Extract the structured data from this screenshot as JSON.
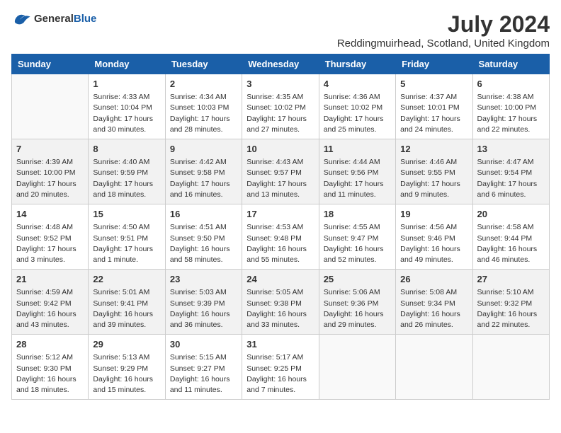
{
  "header": {
    "logo_general": "General",
    "logo_blue": "Blue",
    "month_title": "July 2024",
    "location": "Reddingmuirhead, Scotland, United Kingdom"
  },
  "days_of_week": [
    "Sunday",
    "Monday",
    "Tuesday",
    "Wednesday",
    "Thursday",
    "Friday",
    "Saturday"
  ],
  "weeks": [
    [
      {
        "day": "",
        "info": ""
      },
      {
        "day": "1",
        "info": "Sunrise: 4:33 AM\nSunset: 10:04 PM\nDaylight: 17 hours and 30 minutes."
      },
      {
        "day": "2",
        "info": "Sunrise: 4:34 AM\nSunset: 10:03 PM\nDaylight: 17 hours and 28 minutes."
      },
      {
        "day": "3",
        "info": "Sunrise: 4:35 AM\nSunset: 10:02 PM\nDaylight: 17 hours and 27 minutes."
      },
      {
        "day": "4",
        "info": "Sunrise: 4:36 AM\nSunset: 10:02 PM\nDaylight: 17 hours and 25 minutes."
      },
      {
        "day": "5",
        "info": "Sunrise: 4:37 AM\nSunset: 10:01 PM\nDaylight: 17 hours and 24 minutes."
      },
      {
        "day": "6",
        "info": "Sunrise: 4:38 AM\nSunset: 10:00 PM\nDaylight: 17 hours and 22 minutes."
      }
    ],
    [
      {
        "day": "7",
        "info": "Sunrise: 4:39 AM\nSunset: 10:00 PM\nDaylight: 17 hours and 20 minutes."
      },
      {
        "day": "8",
        "info": "Sunrise: 4:40 AM\nSunset: 9:59 PM\nDaylight: 17 hours and 18 minutes."
      },
      {
        "day": "9",
        "info": "Sunrise: 4:42 AM\nSunset: 9:58 PM\nDaylight: 17 hours and 16 minutes."
      },
      {
        "day": "10",
        "info": "Sunrise: 4:43 AM\nSunset: 9:57 PM\nDaylight: 17 hours and 13 minutes."
      },
      {
        "day": "11",
        "info": "Sunrise: 4:44 AM\nSunset: 9:56 PM\nDaylight: 17 hours and 11 minutes."
      },
      {
        "day": "12",
        "info": "Sunrise: 4:46 AM\nSunset: 9:55 PM\nDaylight: 17 hours and 9 minutes."
      },
      {
        "day": "13",
        "info": "Sunrise: 4:47 AM\nSunset: 9:54 PM\nDaylight: 17 hours and 6 minutes."
      }
    ],
    [
      {
        "day": "14",
        "info": "Sunrise: 4:48 AM\nSunset: 9:52 PM\nDaylight: 17 hours and 3 minutes."
      },
      {
        "day": "15",
        "info": "Sunrise: 4:50 AM\nSunset: 9:51 PM\nDaylight: 17 hours and 1 minute."
      },
      {
        "day": "16",
        "info": "Sunrise: 4:51 AM\nSunset: 9:50 PM\nDaylight: 16 hours and 58 minutes."
      },
      {
        "day": "17",
        "info": "Sunrise: 4:53 AM\nSunset: 9:48 PM\nDaylight: 16 hours and 55 minutes."
      },
      {
        "day": "18",
        "info": "Sunrise: 4:55 AM\nSunset: 9:47 PM\nDaylight: 16 hours and 52 minutes."
      },
      {
        "day": "19",
        "info": "Sunrise: 4:56 AM\nSunset: 9:46 PM\nDaylight: 16 hours and 49 minutes."
      },
      {
        "day": "20",
        "info": "Sunrise: 4:58 AM\nSunset: 9:44 PM\nDaylight: 16 hours and 46 minutes."
      }
    ],
    [
      {
        "day": "21",
        "info": "Sunrise: 4:59 AM\nSunset: 9:42 PM\nDaylight: 16 hours and 43 minutes."
      },
      {
        "day": "22",
        "info": "Sunrise: 5:01 AM\nSunset: 9:41 PM\nDaylight: 16 hours and 39 minutes."
      },
      {
        "day": "23",
        "info": "Sunrise: 5:03 AM\nSunset: 9:39 PM\nDaylight: 16 hours and 36 minutes."
      },
      {
        "day": "24",
        "info": "Sunrise: 5:05 AM\nSunset: 9:38 PM\nDaylight: 16 hours and 33 minutes."
      },
      {
        "day": "25",
        "info": "Sunrise: 5:06 AM\nSunset: 9:36 PM\nDaylight: 16 hours and 29 minutes."
      },
      {
        "day": "26",
        "info": "Sunrise: 5:08 AM\nSunset: 9:34 PM\nDaylight: 16 hours and 26 minutes."
      },
      {
        "day": "27",
        "info": "Sunrise: 5:10 AM\nSunset: 9:32 PM\nDaylight: 16 hours and 22 minutes."
      }
    ],
    [
      {
        "day": "28",
        "info": "Sunrise: 5:12 AM\nSunset: 9:30 PM\nDaylight: 16 hours and 18 minutes."
      },
      {
        "day": "29",
        "info": "Sunrise: 5:13 AM\nSunset: 9:29 PM\nDaylight: 16 hours and 15 minutes."
      },
      {
        "day": "30",
        "info": "Sunrise: 5:15 AM\nSunset: 9:27 PM\nDaylight: 16 hours and 11 minutes."
      },
      {
        "day": "31",
        "info": "Sunrise: 5:17 AM\nSunset: 9:25 PM\nDaylight: 16 hours and 7 minutes."
      },
      {
        "day": "",
        "info": ""
      },
      {
        "day": "",
        "info": ""
      },
      {
        "day": "",
        "info": ""
      }
    ]
  ]
}
